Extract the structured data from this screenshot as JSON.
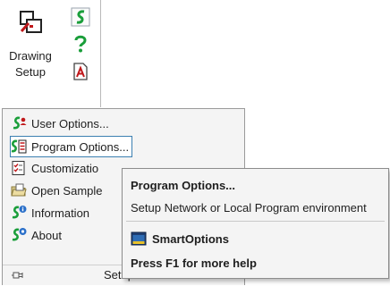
{
  "ribbon": {
    "drawing_setup_label": "Drawing\nSetup"
  },
  "menu": {
    "items": [
      {
        "label": "User Options...",
        "icon": "user-options-icon"
      },
      {
        "label": "Program Options...",
        "icon": "program-options-icon"
      },
      {
        "label": "Customizatio",
        "icon": "customization-icon"
      },
      {
        "label": "Open Sample",
        "icon": "open-sample-icon"
      },
      {
        "label": "Information",
        "icon": "information-icon"
      },
      {
        "label": "About",
        "icon": "about-icon"
      }
    ],
    "footer_label": "Setup"
  },
  "tooltip": {
    "title": "Program Options...",
    "description": "Setup Network or Local Program environment",
    "link_label": "SmartOptions",
    "help": "Press F1 for more help"
  },
  "colors": {
    "highlight_border": "#3c7fb1",
    "menu_bg": "#f4f4f4",
    "accent_green": "#1a9e3a"
  }
}
